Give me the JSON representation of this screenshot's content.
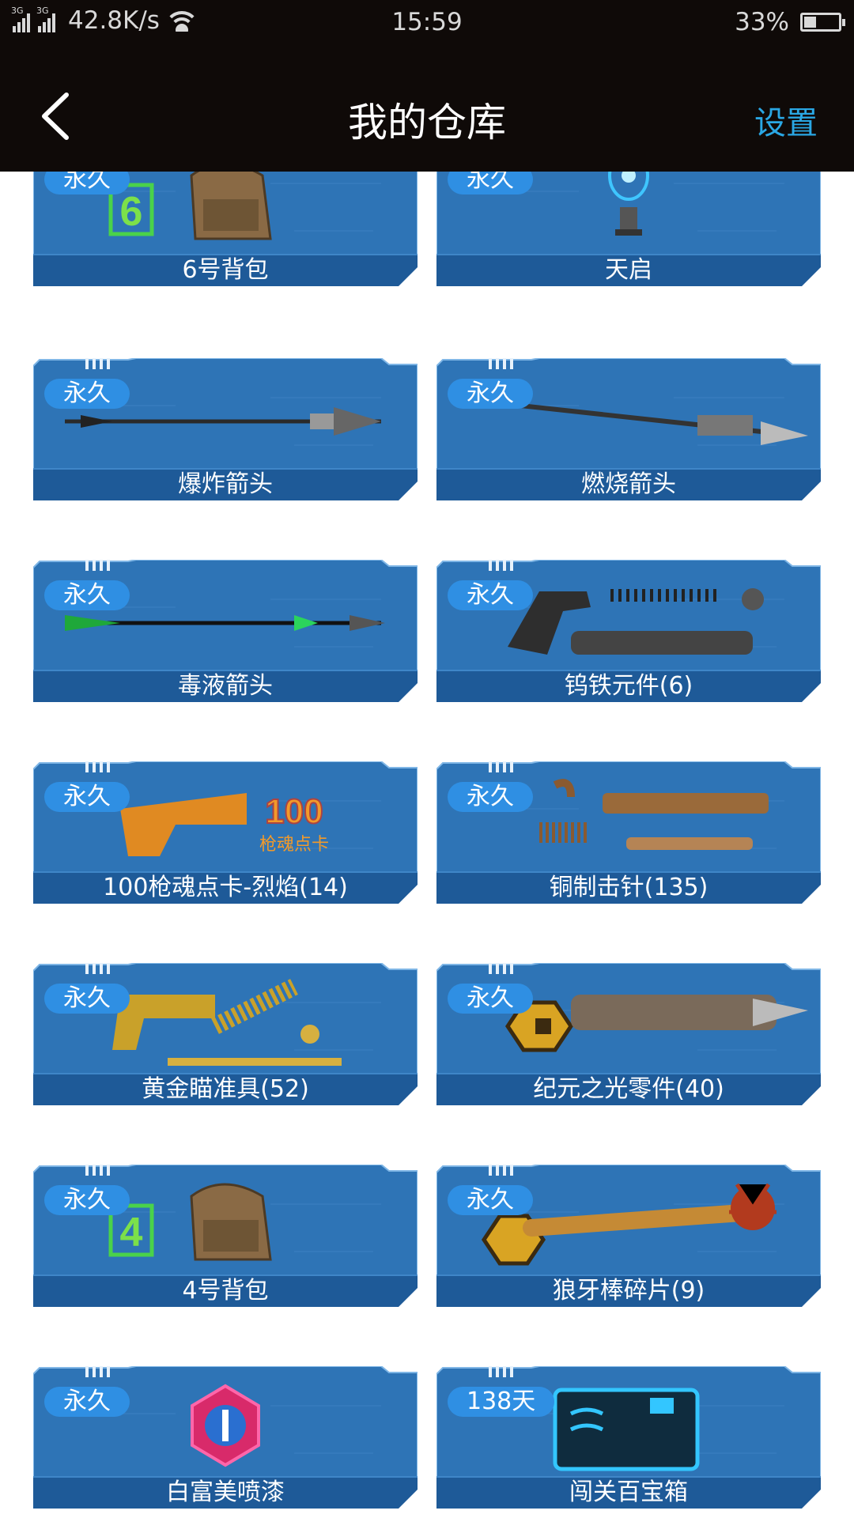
{
  "status_bar": {
    "network_1": "3G",
    "network_2": "3G",
    "speed": "42.8K/s",
    "time": "15:59",
    "battery": "33%",
    "battery_level": 0.33
  },
  "nav": {
    "title": "我的仓库",
    "settings_label": "设置",
    "back_icon": "chevron-left-icon"
  },
  "colors": {
    "nav_bg": "#0f0a08",
    "accent": "#2aa7e4",
    "card_bg": "#2e74b6",
    "card_band": "#1e5a98",
    "tag_bg": "#2f8fe3"
  },
  "items": [
    {
      "tag": "永久",
      "name": "6号背包",
      "icon": "backpack-6-icon"
    },
    {
      "tag": "永久",
      "name": "天启",
      "icon": "energy-orb-icon"
    },
    {
      "tag": "永久",
      "name": "爆炸箭头",
      "icon": "arrow-explosive-icon"
    },
    {
      "tag": "永久",
      "name": "燃烧箭头",
      "icon": "arrow-fire-icon"
    },
    {
      "tag": "永久",
      "name": "毒液箭头",
      "icon": "arrow-venom-icon"
    },
    {
      "tag": "永久",
      "name": "钨铁元件(6)",
      "icon": "gun-parts-icon"
    },
    {
      "tag": "永久",
      "name": "100枪魂点卡-烈焰(14)",
      "icon": "points-card-icon"
    },
    {
      "tag": "永久",
      "name": "铜制击针(135)",
      "icon": "copper-pin-icon"
    },
    {
      "tag": "永久",
      "name": "黄金瞄准具(52)",
      "icon": "gold-scope-icon"
    },
    {
      "tag": "永久",
      "name": "纪元之光零件(40)",
      "icon": "weapon-part-icon"
    },
    {
      "tag": "永久",
      "name": "4号背包",
      "icon": "backpack-4-icon"
    },
    {
      "tag": "永久",
      "name": "狼牙棒碎片(9)",
      "icon": "spiked-club-icon"
    },
    {
      "tag": "永久",
      "name": "白富美喷漆",
      "icon": "spray-badge-icon"
    },
    {
      "tag": "138天",
      "name": "闯关百宝箱",
      "icon": "treasure-box-icon"
    }
  ]
}
